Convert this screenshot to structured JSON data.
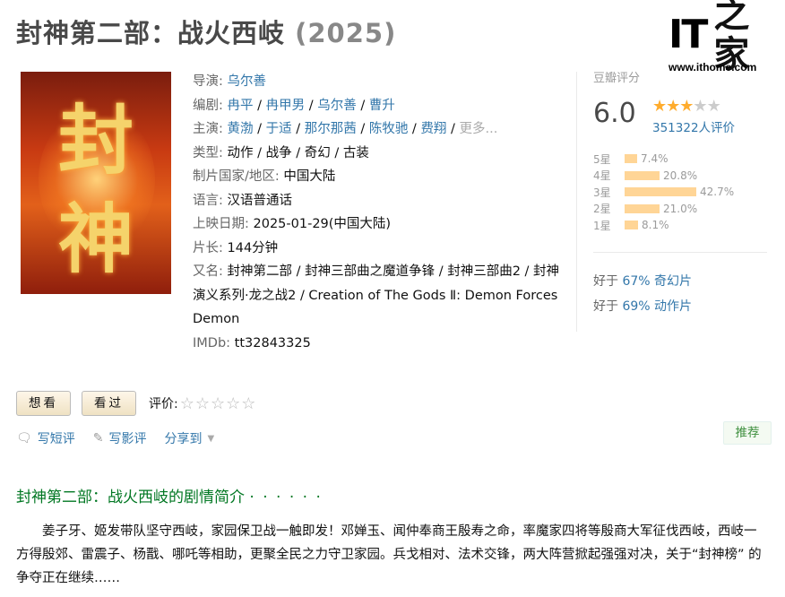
{
  "title": {
    "name": "封神第二部：战火西岐",
    "year": "(2025)"
  },
  "watermark": {
    "logo_it": "IT",
    "logo_zhi": "之家",
    "url": "www.ithome.com"
  },
  "poster": {
    "big_char_1": "封",
    "big_char_2": "神"
  },
  "info": {
    "director_label": "导演:",
    "director": "乌尔善",
    "writer_label": "编剧:",
    "writers": [
      "冉平",
      "冉甲男",
      "乌尔善",
      "曹升"
    ],
    "cast_label": "主演:",
    "cast": [
      "黄渤",
      "于适",
      "那尔那茜",
      "陈牧驰",
      "费翔"
    ],
    "more": "更多...",
    "genre_label": "类型:",
    "genres": [
      "动作",
      "战争",
      "奇幻",
      "古装"
    ],
    "country_label": "制片国家/地区:",
    "country": "中国大陆",
    "language_label": "语言:",
    "language": "汉语普通话",
    "release_label": "上映日期:",
    "release": "2025-01-29(中国大陆)",
    "runtime_label": "片长:",
    "runtime": "144分钟",
    "aka_label": "又名:",
    "aka": "封神第二部 / 封神三部曲之魔道争锋 / 封神三部曲2 / 封神演义系列·龙之战2 / Creation of The Gods Ⅱ: Demon Forces Demon",
    "imdb_label": "IMDb:",
    "imdb": "tt32843325"
  },
  "rating": {
    "label": "豆瓣评分",
    "score": "6.0",
    "stars_filled": 3,
    "stars_total": 5,
    "votes": "351322人评价",
    "distribution": [
      {
        "star": "5星",
        "pct": "7.4%",
        "value": 7.4
      },
      {
        "star": "4星",
        "pct": "20.8%",
        "value": 20.8
      },
      {
        "star": "3星",
        "pct": "42.7%",
        "value": 42.7
      },
      {
        "star": "2星",
        "pct": "21.0%",
        "value": 21.0
      },
      {
        "star": "1星",
        "pct": "8.1%",
        "value": 8.1
      }
    ],
    "better_than": [
      {
        "prefix": "好于",
        "pct": "67%",
        "genre": "奇幻片"
      },
      {
        "prefix": "好于",
        "pct": "69%",
        "genre": "动作片"
      }
    ]
  },
  "actions": {
    "want": "想看",
    "watched": "看过",
    "rate_label": "评价:",
    "write_short": "写短评",
    "write_review": "写影评",
    "share": "分享到",
    "recommend": "推荐"
  },
  "synopsis": {
    "title": "封神第二部：战火西岐的剧情简介",
    "dots": "· · · · · ·",
    "text": "姜子牙、姬发带队坚守西岐，家园保卫战一触即发！邓婵玉、闻仲奉商王殷寿之命，率魔家四将等殷商大军征伐西岐，西岐一方得殷郊、雷震子、杨戬、哪吒等相助，更聚全民之力守卫家园。兵戈相对、法术交锋，两大阵营掀起强强对决，关于“封神榜” 的争夺正在继续……"
  }
}
